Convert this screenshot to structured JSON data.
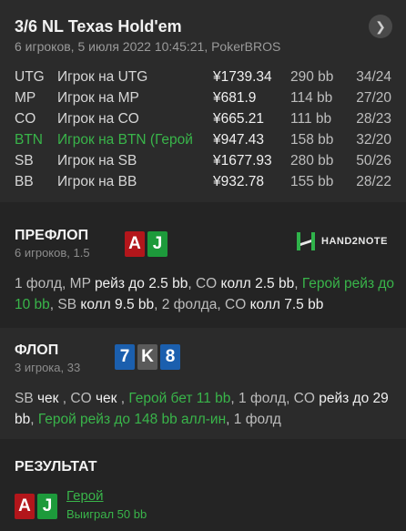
{
  "header": {
    "title": "3/6 NL Texas Hold'em",
    "subtitle": "6 игроков, 5 июля 2022 10:45:21, PokerBROS",
    "nav_icon": "chevron-right-icon"
  },
  "players": [
    {
      "pos": "UTG",
      "name": "Игрок на UTG",
      "stack": "¥1739.34",
      "bb": "290 bb",
      "ratio": "34/24",
      "hero": false
    },
    {
      "pos": "MP",
      "name": "Игрок на MP",
      "stack": "¥681.9",
      "bb": "114 bb",
      "ratio": "27/20",
      "hero": false
    },
    {
      "pos": "CO",
      "name": "Игрок на CO",
      "stack": "¥665.21",
      "bb": "111 bb",
      "ratio": "28/23",
      "hero": false
    },
    {
      "pos": "BTN",
      "name": "Игрок на BTN (Герой",
      "stack": "¥947.43",
      "bb": "158 bb",
      "ratio": "32/20",
      "hero": true
    },
    {
      "pos": "SB",
      "name": "Игрок на SB",
      "stack": "¥1677.93",
      "bb": "280 bb",
      "ratio": "50/26",
      "hero": false
    },
    {
      "pos": "BB",
      "name": "Игрок на BB",
      "stack": "¥932.78",
      "bb": "155 bb",
      "ratio": "28/22",
      "hero": false
    }
  ],
  "preflop": {
    "title": "ПРЕФЛОП",
    "subtitle": "6 игроков, 1.5",
    "cards": [
      "A",
      "J"
    ],
    "logo": "HAND2NOTE",
    "actions": [
      {
        "t": "1 фолд, MP ",
        "c": "plain"
      },
      {
        "t": "рейз до 2.5 bb",
        "c": "amt"
      },
      {
        "t": ", CO ",
        "c": "plain"
      },
      {
        "t": "колл 2.5 bb",
        "c": "amt"
      },
      {
        "t": ", ",
        "c": "plain"
      },
      {
        "t": "Герой рейз до 10 bb",
        "c": "hero"
      },
      {
        "t": ", SB ",
        "c": "plain"
      },
      {
        "t": "колл 9.5 bb",
        "c": "amt"
      },
      {
        "t": ", 2 фолда, CO ",
        "c": "plain"
      },
      {
        "t": "колл 7.5 bb",
        "c": "amt"
      }
    ]
  },
  "flop": {
    "title": "ФЛОП",
    "subtitle": "3 игрока, 33",
    "cards": [
      "7",
      "K",
      "8"
    ],
    "actions": [
      {
        "t": "SB ",
        "c": "plain"
      },
      {
        "t": "чек",
        "c": "amt"
      },
      {
        "t": " , CO ",
        "c": "plain"
      },
      {
        "t": "чек",
        "c": "amt"
      },
      {
        "t": " , ",
        "c": "plain"
      },
      {
        "t": "Герой бет 11 bb",
        "c": "hero"
      },
      {
        "t": ", 1 фолд, CO ",
        "c": "plain"
      },
      {
        "t": "рейз до 29 bb",
        "c": "amt"
      },
      {
        "t": ", ",
        "c": "plain"
      },
      {
        "t": "Герой рейз до 148 bb алл-ин",
        "c": "hero"
      },
      {
        "t": ", 1 фолд",
        "c": "plain"
      }
    ]
  },
  "result": {
    "title": "РЕЗУЛЬТАТ",
    "cards": [
      "A",
      "J"
    ],
    "hero_label": "Герой",
    "win_text": "Выиграл 50 bb"
  },
  "colors": {
    "hero": "#39b54a",
    "card_red": "#b3161b",
    "card_green": "#1d9a3b",
    "card_blue": "#1b5fae",
    "card_gray": "#5a5a5a"
  }
}
